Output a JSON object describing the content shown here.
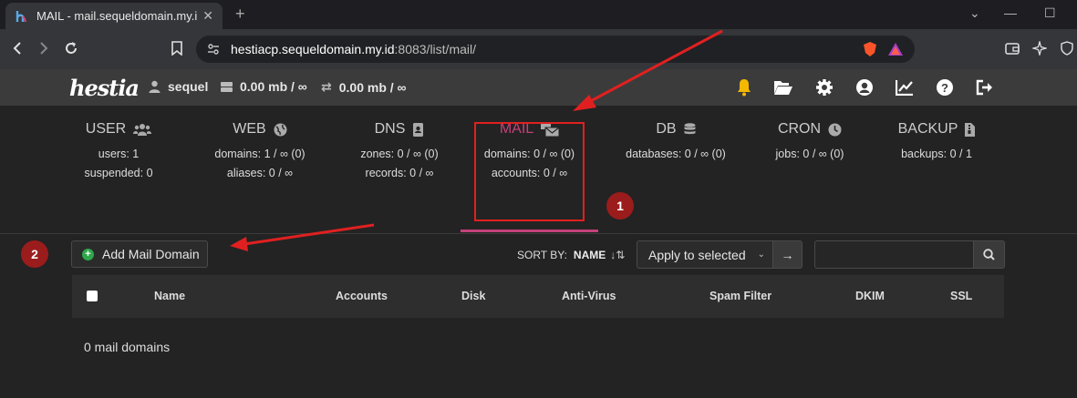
{
  "browser": {
    "tab_title": "MAIL - mail.sequeldomain.my.id",
    "new_tab": "+",
    "url_host": "hestiacp.sequeldomain.my.id",
    "url_rest": ":8083/list/mail/"
  },
  "header": {
    "logo": "hestia",
    "username": "sequel",
    "disk_usage": "0.00 mb / ∞",
    "bandwidth_usage": "0.00 mb / ∞"
  },
  "stats": [
    {
      "title": "USER",
      "line1": "users: 1",
      "line2": "suspended: 0",
      "icon": "users-icon"
    },
    {
      "title": "WEB",
      "line1": "domains: 1 / ∞ (0)",
      "line2": "aliases: 0 / ∞",
      "icon": "globe-icon"
    },
    {
      "title": "DNS",
      "line1": "zones: 0 / ∞ (0)",
      "line2": "records: 0 / ∞",
      "icon": "address-book-icon"
    },
    {
      "title": "MAIL",
      "line1": "domains: 0 / ∞ (0)",
      "line2": "accounts: 0 / ∞",
      "icon": "mail-bulk-icon"
    },
    {
      "title": "DB",
      "line1": "databases: 0 / ∞ (0)",
      "line2": "",
      "icon": "database-icon"
    },
    {
      "title": "CRON",
      "line1": "jobs: 0 / ∞ (0)",
      "line2": "",
      "icon": "clock-icon"
    },
    {
      "title": "BACKUP",
      "line1": "backups: 0 / 1",
      "line2": "",
      "icon": "file-zip-icon"
    }
  ],
  "annotations": {
    "badge1": "1",
    "badge2": "2"
  },
  "toolbar": {
    "add_label": "Add Mail Domain",
    "sort_label": "SORT BY:",
    "sort_value": "NAME",
    "bulk_action": "Apply to selected",
    "search_placeholder": ""
  },
  "table": {
    "columns": [
      "Name",
      "Accounts",
      "Disk",
      "Anti-Virus",
      "Spam Filter",
      "DKIM",
      "SSL"
    ],
    "empty_text": "0 mail domains"
  },
  "colors": {
    "accent": "#c4417a",
    "annotation_red": "#e02020",
    "badge": "#9b1c1c"
  }
}
